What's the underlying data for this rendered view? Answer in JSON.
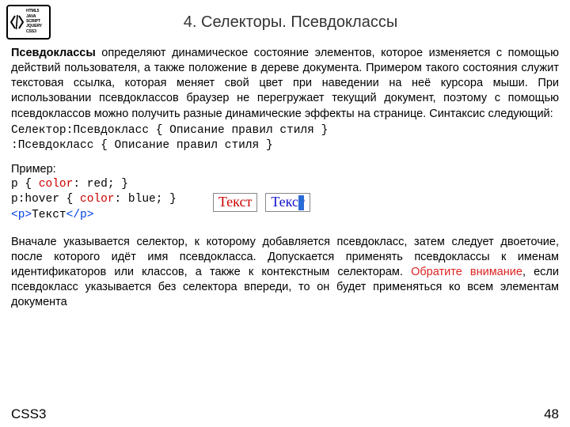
{
  "header": {
    "logo_tags": [
      "HTML5",
      "JAVA SCRIPT",
      "JQUERY",
      "CSS3"
    ],
    "title": "4. Селекторы. Псевдоклассы"
  },
  "intro": {
    "bold": "Псевдоклассы",
    "rest": " определяют динамическое состояние элементов, которое изменяется с помощью действий пользователя, а также положение в дереве документа. Примером такого состояния служит текстовая ссылка, которая меняет свой цвет при наведении на неё курсора мыши. При использовании псевдоклассов браузер не перегружает текущий документ, поэтому с помощью псевдоклассов можно получить разные динамические эффекты на странице. Синтаксис следующий:"
  },
  "syntax": {
    "line1": "Селектор:Псевдокласс { Описание правил стиля }",
    "line2": ":Псевдокласс { Описание правил стиля }"
  },
  "example": {
    "label": "Пример:",
    "l1a": "p { ",
    "l1b": "color",
    "l1c": ": red; }",
    "l2a": "p:hover { ",
    "l2b": "color",
    "l2c": ": blue; }",
    "l3a": "<p>",
    "l3b": "Текст",
    "l3c": "</p>",
    "sample1": "Текст",
    "sample2": "Текст"
  },
  "explain": {
    "before": "Вначале указывается селектор, к которому добавляется псевдокласс, затем следует двоеточие, после которого идёт имя псевдокласса. Допускается применять псевдоклассы к именам идентификаторов или классов, а также к контекстным селекторам. ",
    "attn": "Обратите внимание",
    "after": ", если псевдокласс указывается без селектора впереди, то он будет применяться ко всем элементам документа"
  },
  "footer": {
    "left": "CSS3",
    "page": "48"
  }
}
